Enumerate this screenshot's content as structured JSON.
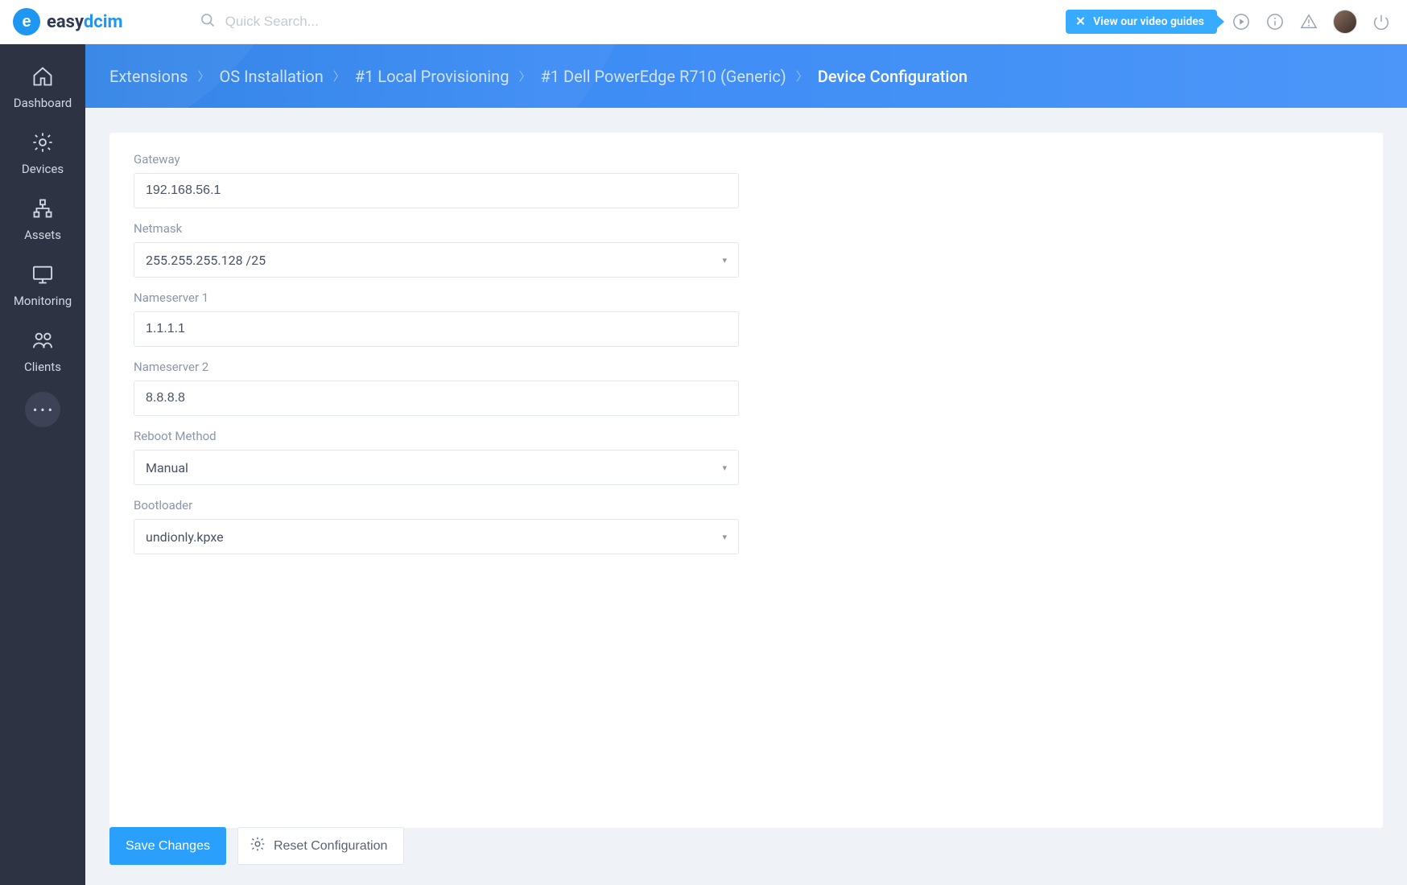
{
  "brand": {
    "name_a": "easy",
    "name_b": "dcim"
  },
  "search": {
    "placeholder": "Quick Search..."
  },
  "topbar": {
    "video_guides": "View our video guides"
  },
  "sidebar": {
    "items": [
      {
        "id": "dashboard",
        "label": "Dashboard"
      },
      {
        "id": "devices",
        "label": "Devices"
      },
      {
        "id": "assets",
        "label": "Assets"
      },
      {
        "id": "monitoring",
        "label": "Monitoring"
      },
      {
        "id": "clients",
        "label": "Clients"
      }
    ]
  },
  "breadcrumb": {
    "items": [
      "Extensions",
      "OS Installation",
      "#1 Local Provisioning",
      "#1 Dell PowerEdge R710 (Generic)"
    ],
    "current": "Device Configuration"
  },
  "form": {
    "gateway": {
      "label": "Gateway",
      "value": "192.168.56.1"
    },
    "netmask": {
      "label": "Netmask",
      "value": "255.255.255.128 /25"
    },
    "nameserver1": {
      "label": "Nameserver 1",
      "value": "1.1.1.1"
    },
    "nameserver2": {
      "label": "Nameserver 2",
      "value": "8.8.8.8"
    },
    "reboot_method": {
      "label": "Reboot Method",
      "value": "Manual"
    },
    "bootloader": {
      "label": "Bootloader",
      "value": "undionly.kpxe"
    }
  },
  "actions": {
    "save": "Save Changes",
    "reset": "Reset Configuration"
  }
}
